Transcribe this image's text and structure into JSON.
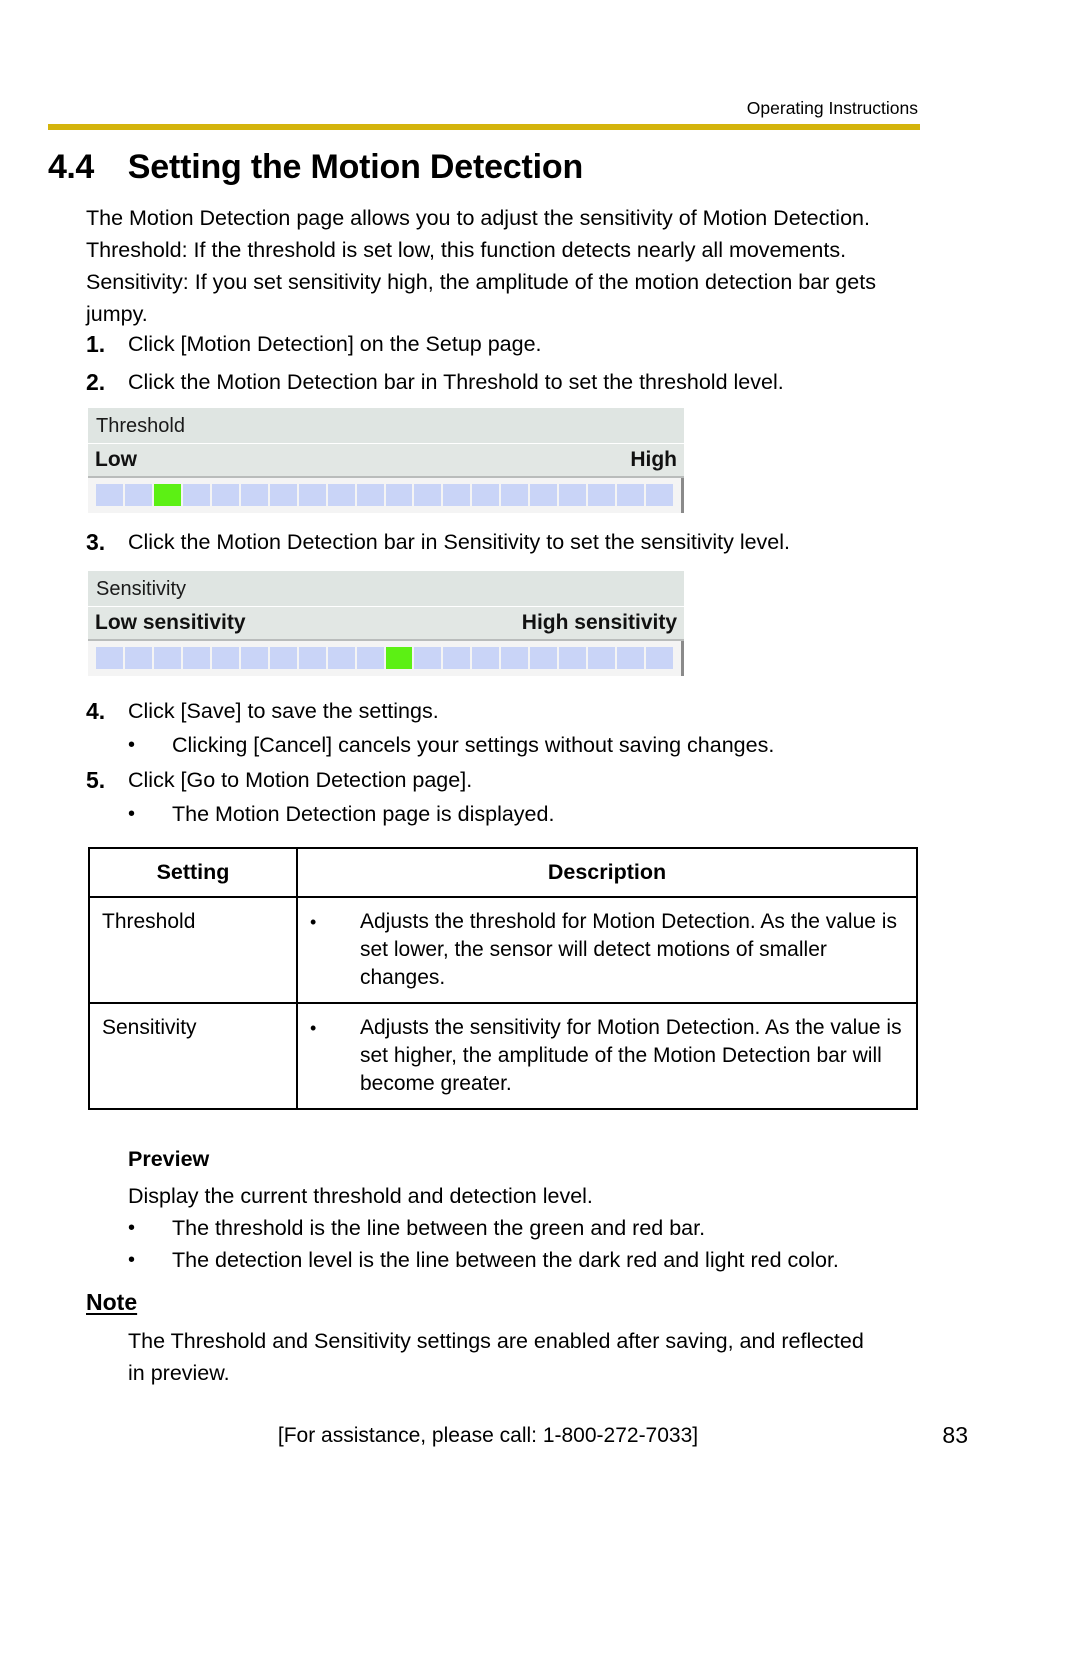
{
  "header": {
    "running_title": "Operating Instructions",
    "rule_color": "#d4b40c"
  },
  "section": {
    "number": "4.4",
    "title": "Setting the Motion Detection"
  },
  "intro": {
    "line1": "The Motion Detection page allows you to adjust the sensitivity of Motion Detection.",
    "line2": "Threshold: If the threshold is set low, this function detects nearly all movements.",
    "line3": "Sensitivity: If you set sensitivity high, the amplitude of the motion detection bar gets",
    "line4": "jumpy."
  },
  "steps": [
    {
      "num": "1.",
      "text": "Click [Motion Detection] on the Setup page."
    },
    {
      "num": "2.",
      "text": "Click the Motion Detection bar in Threshold to set the threshold level."
    },
    {
      "num": "3.",
      "text": "Click the Motion Detection bar in Sensitivity to set the sensitivity level."
    },
    {
      "num": "4.",
      "text": "Click [Save] to save the settings."
    },
    {
      "num": "5.",
      "text": "Click [Go to Motion Detection page]."
    }
  ],
  "step_bullets": {
    "after_step4": "Clicking [Cancel] cancels your settings without saving changes.",
    "after_step5": "The Motion Detection page is displayed."
  },
  "threshold_widget": {
    "title": "Threshold",
    "label_left": "Low",
    "label_right": "High",
    "segment_count": 20,
    "active_segment": 3,
    "active_color": "#5cf014",
    "segment_color": "#c9d4f7"
  },
  "sensitivity_widget": {
    "title": "Sensitivity",
    "label_left": "Low sensitivity",
    "label_right": "High sensitivity",
    "segment_count": 20,
    "active_segment": 11,
    "active_color": "#5cf014",
    "segment_color": "#c9d4f7"
  },
  "table": {
    "headers": [
      "Setting",
      "Description"
    ],
    "rows": [
      {
        "setting": "Threshold",
        "description": "Adjusts the threshold for Motion Detection. As the value is set lower, the sensor will detect motions of smaller changes."
      },
      {
        "setting": "Sensitivity",
        "description": "Adjusts the sensitivity for Motion Detection. As the value is set higher, the amplitude of the Motion Detection bar will become greater."
      }
    ]
  },
  "preview": {
    "heading": "Preview",
    "description": "Display the current threshold and detection level.",
    "bullets": [
      "The threshold is the line between the green and red bar.",
      "The detection level is the line between the dark red and light red color."
    ]
  },
  "note": {
    "heading": "Note",
    "line1": "The Threshold and Sensitivity settings are enabled after saving, and reflected",
    "line2": "in preview."
  },
  "footer": {
    "assistance": "[For assistance, please call: 1-800-272-7033]",
    "page_number": "83"
  }
}
